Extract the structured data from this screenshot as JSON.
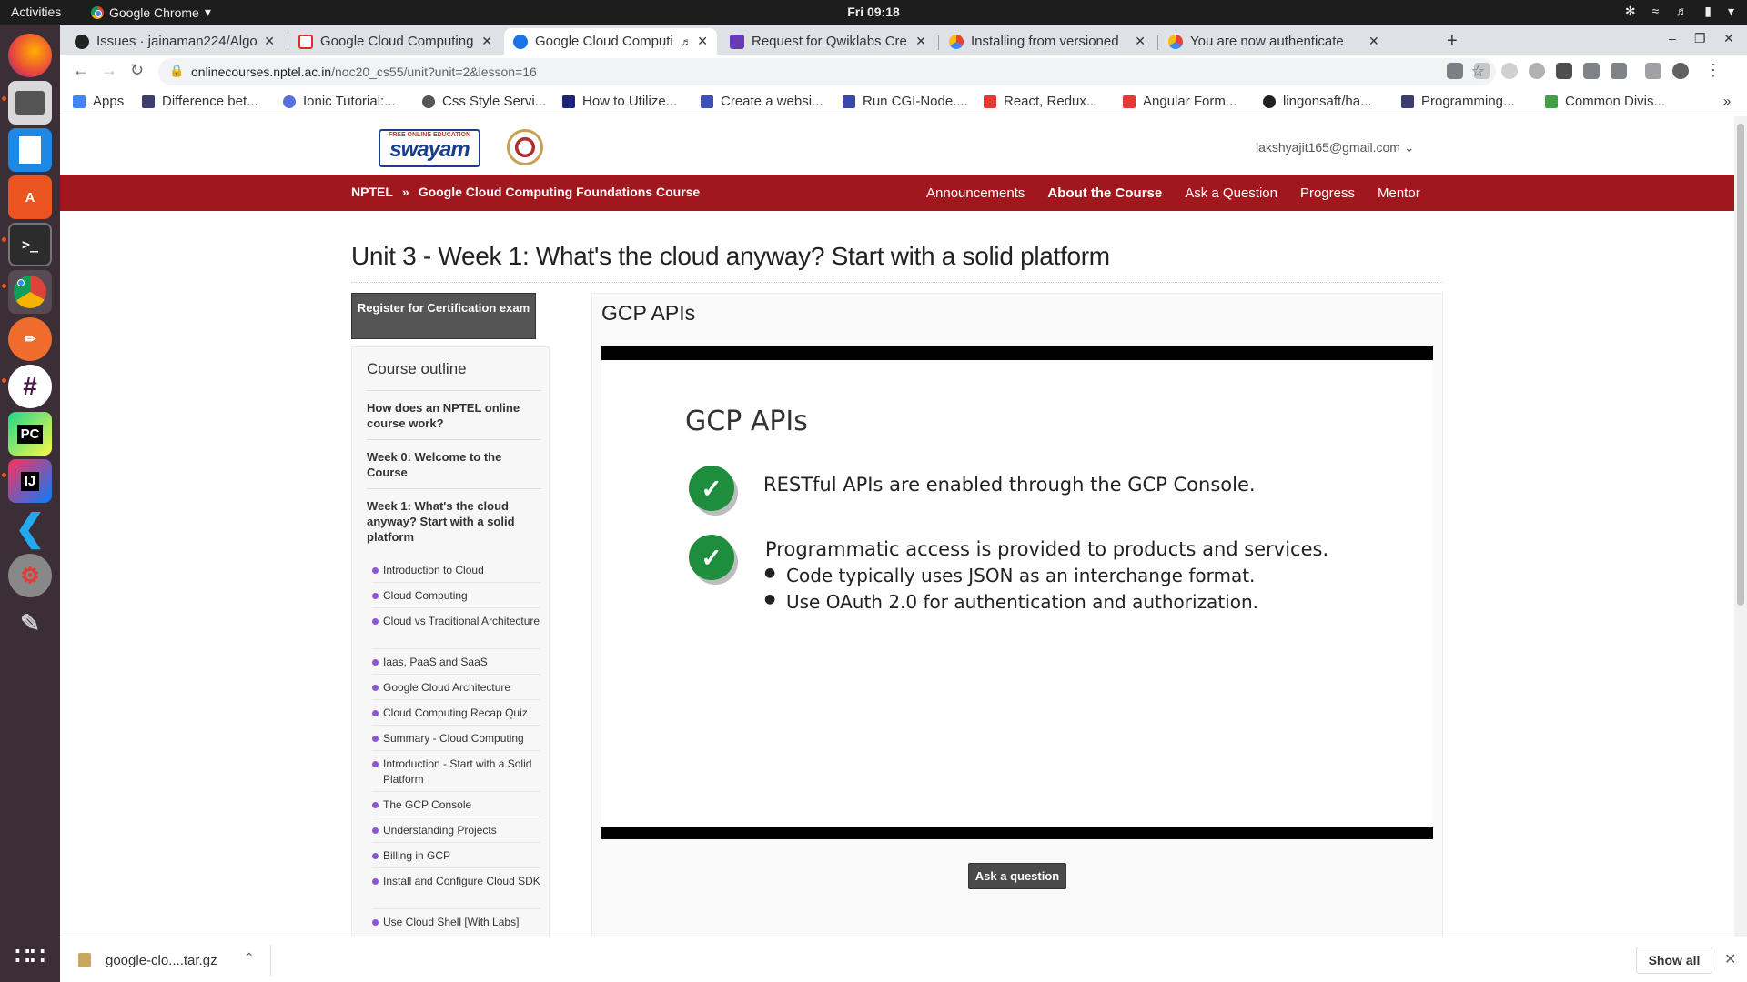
{
  "system": {
    "activities": "Activities",
    "app_name": "Google Chrome",
    "clock": "Fri 09:18"
  },
  "browser": {
    "tabs": [
      {
        "title": "Issues · jainaman224/Algo",
        "icon": "github-icon",
        "active": false
      },
      {
        "title": "Google Cloud Computing",
        "icon": "gmail-icon",
        "active": false
      },
      {
        "title": "Google Cloud Computi",
        "icon": "swayam-icon",
        "active": true
      },
      {
        "title": "Request for Qwiklabs Cre",
        "icon": "forms-icon",
        "active": false
      },
      {
        "title": "Installing from versioned",
        "icon": "gcloud-icon",
        "active": false
      },
      {
        "title": "You are now authenticate",
        "icon": "gcloud-icon",
        "active": false
      }
    ],
    "url_host": "onlinecourses.nptel.ac.in",
    "url_path": "/noc20_cs55/unit?unit=2&lesson=16",
    "bookmarks": [
      {
        "label": "Apps",
        "color": "#4285f4"
      },
      {
        "label": "Difference bet...",
        "color": "#3c3c6e"
      },
      {
        "label": "Ionic Tutorial:...",
        "color": "#5b6ee1"
      },
      {
        "label": "Css Style Servi...",
        "color": "#555555"
      },
      {
        "label": "How to Utilize...",
        "color": "#1a237e"
      },
      {
        "label": "Create a websi...",
        "color": "#3f51b5"
      },
      {
        "label": "Run CGI-Node....",
        "color": "#3949ab"
      },
      {
        "label": "React, Redux...",
        "color": "#e53935"
      },
      {
        "label": "Angular Form...",
        "color": "#e53935"
      },
      {
        "label": "lingonsaft/ha...",
        "color": "#222222"
      },
      {
        "label": "Programming...",
        "color": "#3c3c6e"
      },
      {
        "label": "Common Divis...",
        "color": "#43a047"
      }
    ]
  },
  "site": {
    "logo_word": "swayam",
    "logo_tag": "FREE ONLINE EDUCATION",
    "user_email": "lakshyajit165@gmail.com",
    "breadcrumb": [
      "NPTEL",
      "»",
      "Google Cloud Computing Foundations Course"
    ],
    "nav": [
      "Announcements",
      "About the Course",
      "Ask a Question",
      "Progress",
      "Mentor"
    ],
    "unit_title": "Unit 3 - Week 1: What's the cloud anyway? Start with a solid platform",
    "register_button": "Register for Certification exam",
    "outline": {
      "heading": "Course outline",
      "weeks": [
        "How does an NPTEL online course work?",
        "Week 0: Welcome to the Course",
        "Week 1: What's the cloud anyway? Start with a solid platform"
      ],
      "lessons": [
        "Introduction to Cloud",
        "Cloud Computing",
        "Cloud vs Traditional Architecture",
        "Iaas, PaaS and SaaS",
        "Google Cloud Architecture",
        "Cloud Computing Recap Quiz",
        "Summary - Cloud Computing",
        "Introduction - Start with a Solid Platform",
        "The GCP Console",
        "Understanding Projects",
        "Billing in GCP",
        "Install and Configure Cloud SDK",
        "Use Cloud Shell [With Labs]"
      ]
    },
    "lesson_title": "GCP APIs",
    "slide": {
      "title": "GCP APIs",
      "point1": "RESTful APIs are enabled through the GCP Console.",
      "point2": "Programmatic access is provided to products and services.",
      "bullet1": "Code typically uses JSON as an interchange format.",
      "bullet2": "Use OAuth 2.0 for authentication and authorization."
    },
    "ask_button": "Ask a question"
  },
  "downloads": {
    "file": "google-clo....tar.gz",
    "show_all": "Show all"
  },
  "colors": {
    "nav_bar": "#a0171d",
    "dock": "#3b2e36",
    "check": "#1e8e3e",
    "bullet": "#8b55d6"
  }
}
